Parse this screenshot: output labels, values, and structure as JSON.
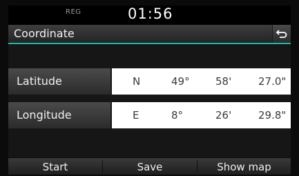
{
  "status": {
    "reg_label": "REG",
    "clock": "01:56"
  },
  "header": {
    "title": "Coordinate",
    "back_icon": "back-arrow-icon"
  },
  "accent_color": "#1fb8a8",
  "latitude": {
    "label": "Latitude",
    "hemisphere": "N",
    "degrees": "49°",
    "minutes": "58'",
    "seconds": "27.0\""
  },
  "longitude": {
    "label": "Longitude",
    "hemisphere": "E",
    "degrees": "8°",
    "minutes": "26'",
    "seconds": "29.8\""
  },
  "footer": {
    "start_label": "Start",
    "save_label": "Save",
    "show_map_label": "Show map"
  }
}
